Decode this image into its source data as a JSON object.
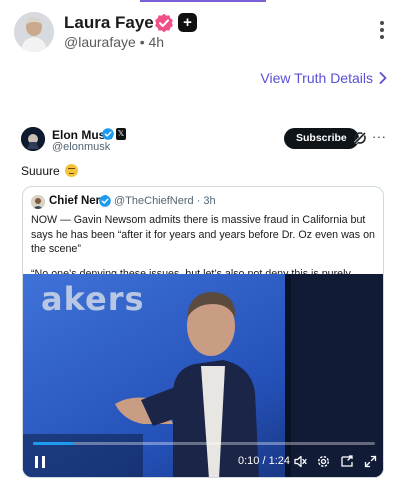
{
  "post": {
    "author_name": "Laura Faye",
    "author_handle": "@laurafaye",
    "separator": "•",
    "age": "4h",
    "plus_badge": "+",
    "view_details_label": "View Truth Details"
  },
  "embed": {
    "name": "Elon Musk",
    "handle": "@elonmusk",
    "subscribe_label": "Subscribe",
    "more_label": "···",
    "x_logo": "𝕏",
    "text": "Suuure",
    "quote": {
      "name": "Chief Nerd",
      "meta": "@TheChiefNerd · 3h",
      "paragraphs": [
        "NOW — Gavin Newsom admits there is massive fraud in California but says he has been “after it for years and years before Dr. Oz even was on the scene”",
        "“No one’s denying these issues, but let’s also not deny this is purely political.”"
      ],
      "video": {
        "overlay_text": "akers",
        "time": "0:10 / 1:24",
        "progress": 0.119
      }
    }
  },
  "colors": {
    "accent": "#7b5fd6",
    "link": "#5a4fd6",
    "verified_pink": "#f0508a",
    "x_verified_blue": "#1d9bf0"
  },
  "icons": [
    "verified-badge-icon",
    "plus-badge-icon",
    "more-vertical-icon",
    "chevron-right-icon",
    "x-logo-icon",
    "grok-icon",
    "more-horizontal-icon",
    "pause-icon",
    "volume-icon",
    "settings-icon",
    "pip-icon",
    "fullscreen-icon"
  ]
}
